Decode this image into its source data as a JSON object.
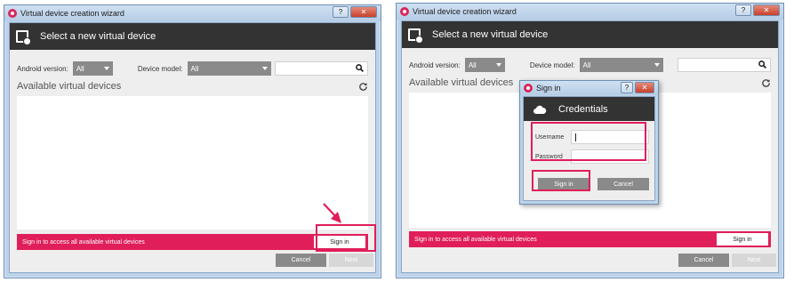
{
  "wizard": {
    "window_title": "Virtual device creation wizard",
    "header_title": "Select a new virtual device",
    "android_version_label": "Android version:",
    "android_version_value": "All",
    "device_model_label": "Device model:",
    "device_model_value": "All",
    "search_placeholder": "",
    "section_title": "Available virtual devices",
    "signin_message": "Sign in to access all available virtual devices",
    "signin_button": "Sign in",
    "cancel_button": "Cancel",
    "next_button": "Next"
  },
  "signin_dialog": {
    "window_title": "Sign in",
    "header_title": "Credentials",
    "username_label": "Username",
    "username_value": "",
    "password_label": "Password",
    "password_value": "",
    "signin_button": "Sign in",
    "cancel_button": "Cancel"
  },
  "caption_buttons": {
    "help": "?",
    "close": "✕"
  },
  "colors": {
    "accent": "#e01e5a",
    "header_bg": "#333333",
    "button_gray": "#8a8a8a",
    "disabled_gray": "#d7d7d7"
  },
  "icons": [
    "app-logo-icon",
    "device-add-icon",
    "search-icon",
    "refresh-icon",
    "cloud-icon",
    "arrow-icon"
  ]
}
